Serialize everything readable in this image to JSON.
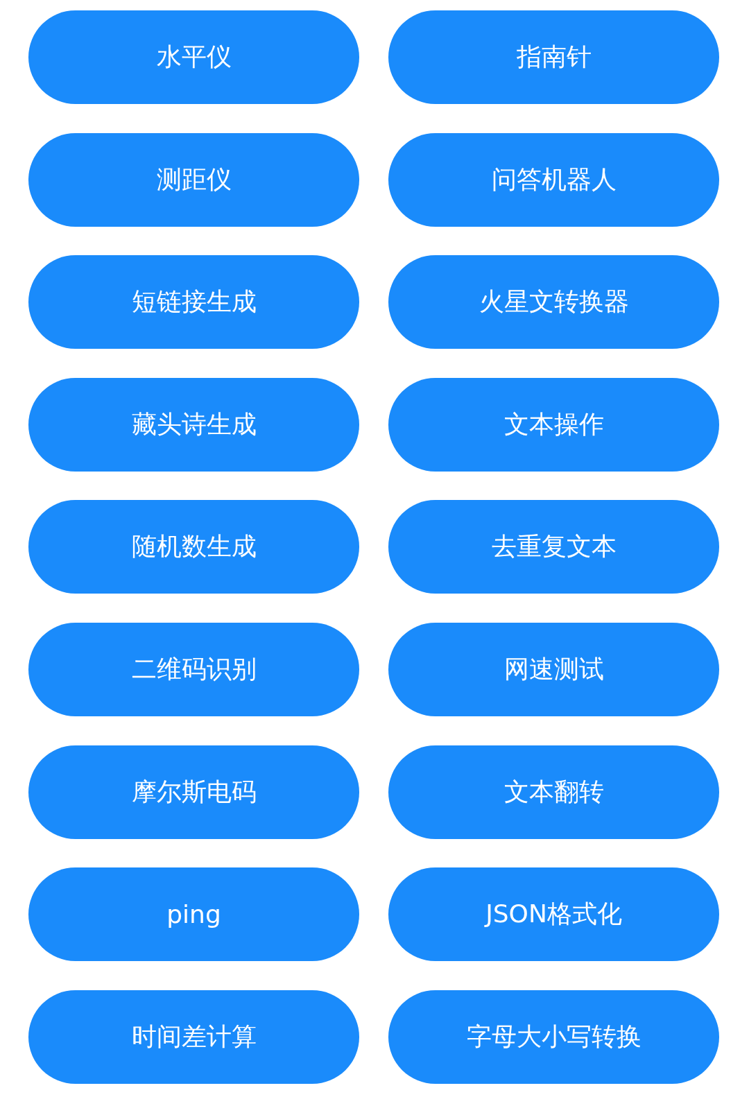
{
  "buttons": [
    {
      "label": "水平仪"
    },
    {
      "label": "指南针"
    },
    {
      "label": "测距仪"
    },
    {
      "label": "问答机器人"
    },
    {
      "label": "短链接生成"
    },
    {
      "label": "火星文转换器"
    },
    {
      "label": "藏头诗生成"
    },
    {
      "label": "文本操作"
    },
    {
      "label": "随机数生成"
    },
    {
      "label": "去重复文本"
    },
    {
      "label": "二维码识别"
    },
    {
      "label": "网速测试"
    },
    {
      "label": "摩尔斯电码"
    },
    {
      "label": "文本翻转"
    },
    {
      "label": "ping"
    },
    {
      "label": "JSON格式化"
    },
    {
      "label": "时间差计算"
    },
    {
      "label": "字母大小写转换"
    }
  ]
}
